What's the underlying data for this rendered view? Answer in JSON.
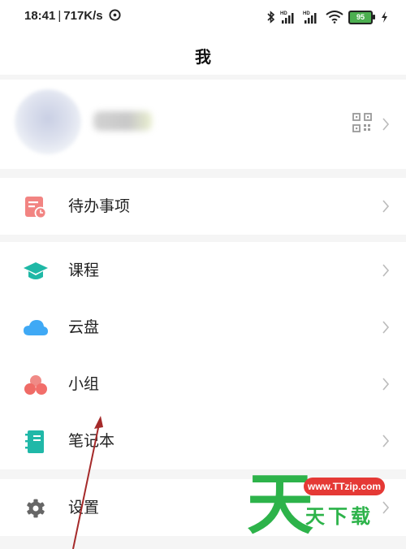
{
  "status_bar": {
    "time": "18:41",
    "network_speed": "717K/s",
    "battery_level": "95",
    "icons": [
      "compass-icon",
      "bluetooth-icon",
      "hd-signal-icon",
      "hd-signal-icon",
      "wifi-icon",
      "battery-icon",
      "charging-icon"
    ]
  },
  "header": {
    "title": "我"
  },
  "profile": {
    "icons": [
      "avatar",
      "qr-code-icon",
      "chevron-right-icon"
    ]
  },
  "menu_groups": [
    [
      {
        "key": "todo",
        "label": "待办事项",
        "icon": "todo-calendar-icon",
        "color": "#f08080"
      }
    ],
    [
      {
        "key": "courses",
        "label": "课程",
        "icon": "graduation-cap-icon",
        "color": "#1fb8a6"
      },
      {
        "key": "cloud",
        "label": "云盘",
        "icon": "cloud-icon",
        "color": "#3fa9f5"
      },
      {
        "key": "group",
        "label": "小组",
        "icon": "group-icon",
        "color": "#ef6b66"
      },
      {
        "key": "notebook",
        "label": "笔记本",
        "icon": "notebook-icon",
        "color": "#20b8a8"
      }
    ],
    [
      {
        "key": "settings",
        "label": "设置",
        "icon": "gear-icon",
        "color": "#666666"
      }
    ]
  ],
  "watermark": {
    "url": "www.TTzip.com",
    "big_char": "天",
    "text": "天下载",
    "color": "#2db34a"
  }
}
